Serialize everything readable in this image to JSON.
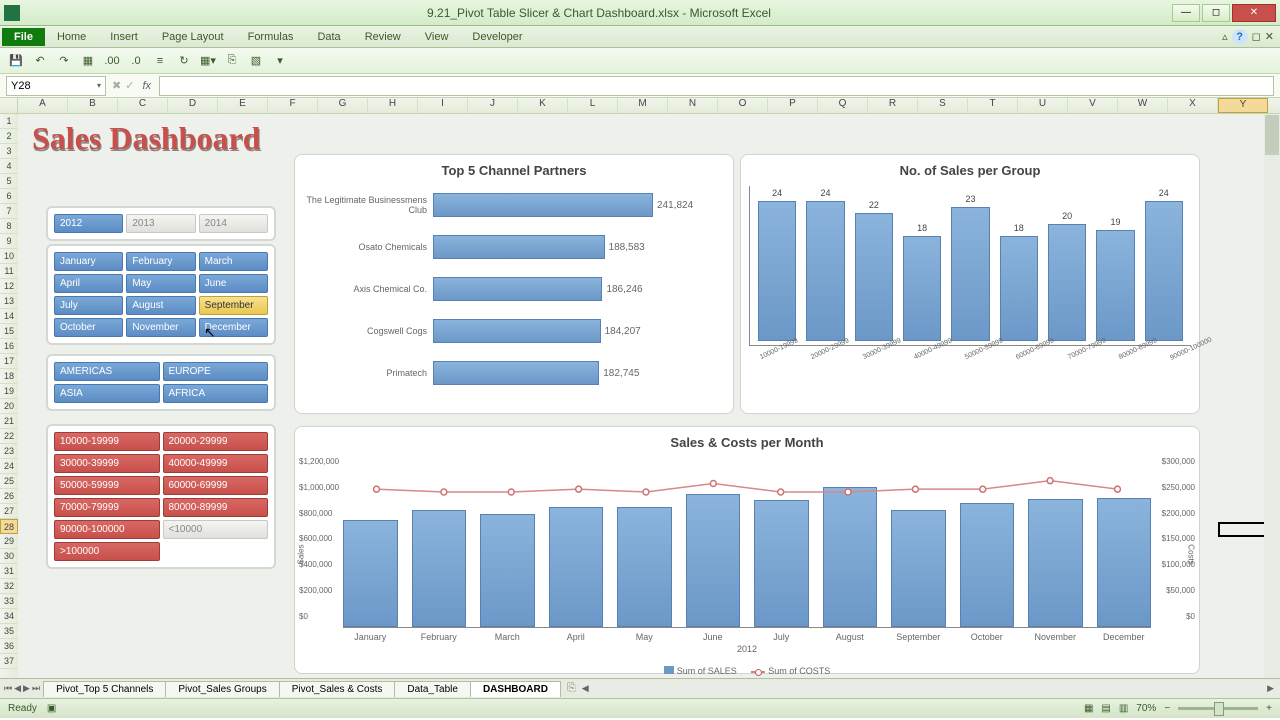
{
  "app": {
    "title": "9.21_Pivot Table Slicer & Chart Dashboard.xlsx - Microsoft Excel",
    "name_box": "Y28",
    "status": "Ready",
    "zoom": "70%"
  },
  "ribbon": {
    "tabs": [
      "File",
      "Home",
      "Insert",
      "Page Layout",
      "Formulas",
      "Data",
      "Review",
      "View",
      "Developer"
    ]
  },
  "columns": [
    "A",
    "B",
    "C",
    "D",
    "E",
    "F",
    "G",
    "H",
    "I",
    "J",
    "K",
    "L",
    "M",
    "N",
    "O",
    "P",
    "Q",
    "R",
    "S",
    "T",
    "U",
    "V",
    "W",
    "X",
    "Y"
  ],
  "dashboard_title": "Sales Dashboard",
  "slicers": {
    "years": [
      {
        "label": "2012",
        "style": "blue"
      },
      {
        "label": "2013",
        "style": "gray"
      },
      {
        "label": "2014",
        "style": "gray"
      }
    ],
    "months": [
      {
        "label": "January",
        "style": "blue"
      },
      {
        "label": "February",
        "style": "blue"
      },
      {
        "label": "March",
        "style": "blue"
      },
      {
        "label": "April",
        "style": "blue"
      },
      {
        "label": "May",
        "style": "blue"
      },
      {
        "label": "June",
        "style": "blue"
      },
      {
        "label": "July",
        "style": "blue"
      },
      {
        "label": "August",
        "style": "blue"
      },
      {
        "label": "September",
        "style": "hl"
      },
      {
        "label": "October",
        "style": "blue"
      },
      {
        "label": "November",
        "style": "blue"
      },
      {
        "label": "December",
        "style": "blue"
      }
    ],
    "regions": [
      {
        "label": "AMERICAS",
        "style": "blue"
      },
      {
        "label": "EUROPE",
        "style": "blue"
      },
      {
        "label": "ASIA",
        "style": "blue"
      },
      {
        "label": "AFRICA",
        "style": "blue"
      }
    ],
    "ranges": [
      {
        "label": "10000-19999",
        "style": "red"
      },
      {
        "label": "20000-29999",
        "style": "red"
      },
      {
        "label": "30000-39999",
        "style": "red"
      },
      {
        "label": "40000-49999",
        "style": "red"
      },
      {
        "label": "50000-59999",
        "style": "red"
      },
      {
        "label": "60000-69999",
        "style": "red"
      },
      {
        "label": "70000-79999",
        "style": "red"
      },
      {
        "label": "80000-89999",
        "style": "red"
      },
      {
        "label": "90000-100000",
        "style": "red"
      },
      {
        "label": "<10000",
        "style": "gray"
      },
      {
        "label": ">100000",
        "style": "red"
      }
    ]
  },
  "chart_data": [
    {
      "type": "bar",
      "title": "Top 5 Channel Partners",
      "orientation": "horizontal",
      "categories": [
        "The Legitimate Businessmens Club",
        "Osato Chemicals",
        "Axis Chemical Co.",
        "Cogswell Cogs",
        "Primatech"
      ],
      "values": [
        241824,
        188583,
        186246,
        184207,
        182745
      ],
      "value_labels": [
        "241,824",
        "188,583",
        "186,246",
        "184,207",
        "182,745"
      ]
    },
    {
      "type": "bar",
      "title": "No. of Sales per Group",
      "categories": [
        "10000-19999",
        "20000-29999",
        "30000-39999",
        "40000-49999",
        "50000-59999",
        "60000-69999",
        "70000-79999",
        "80000-89999",
        "90000-100000"
      ],
      "values": [
        24,
        24,
        22,
        18,
        23,
        18,
        20,
        19,
        24
      ]
    },
    {
      "type": "combo",
      "title": "Sales & Costs per Month",
      "x_categories": [
        "January",
        "February",
        "March",
        "April",
        "May",
        "June",
        "July",
        "August",
        "September",
        "October",
        "November",
        "December"
      ],
      "x_group": "2012",
      "series": [
        {
          "name": "Sum of SALES",
          "type": "bar",
          "axis": "left",
          "values": [
            800000,
            880000,
            850000,
            900000,
            900000,
            1000000,
            950000,
            1050000,
            880000,
            930000,
            960000,
            970000
          ]
        },
        {
          "name": "Sum of COSTS",
          "type": "line",
          "axis": "right",
          "values": [
            245000,
            240000,
            240000,
            245000,
            240000,
            255000,
            240000,
            240000,
            245000,
            245000,
            260000,
            245000
          ]
        }
      ],
      "ylabel_left": "Sales",
      "ylabel_right": "Costs",
      "y_left_ticks": [
        "$1,200,000",
        "$1,000,000",
        "$800,000",
        "$600,000",
        "$400,000",
        "$200,000",
        "$0"
      ],
      "y_right_ticks": [
        "$300,000",
        "$250,000",
        "$200,000",
        "$150,000",
        "$100,000",
        "$50,000",
        "$0"
      ],
      "legend": [
        "Sum of SALES",
        "Sum of COSTS"
      ]
    }
  ],
  "sheet_tabs": [
    "Pivot_Top 5 Channels",
    "Pivot_Sales Groups",
    "Pivot_Sales & Costs",
    "Data_Table",
    "DASHBOARD"
  ],
  "active_sheet": "DASHBOARD"
}
